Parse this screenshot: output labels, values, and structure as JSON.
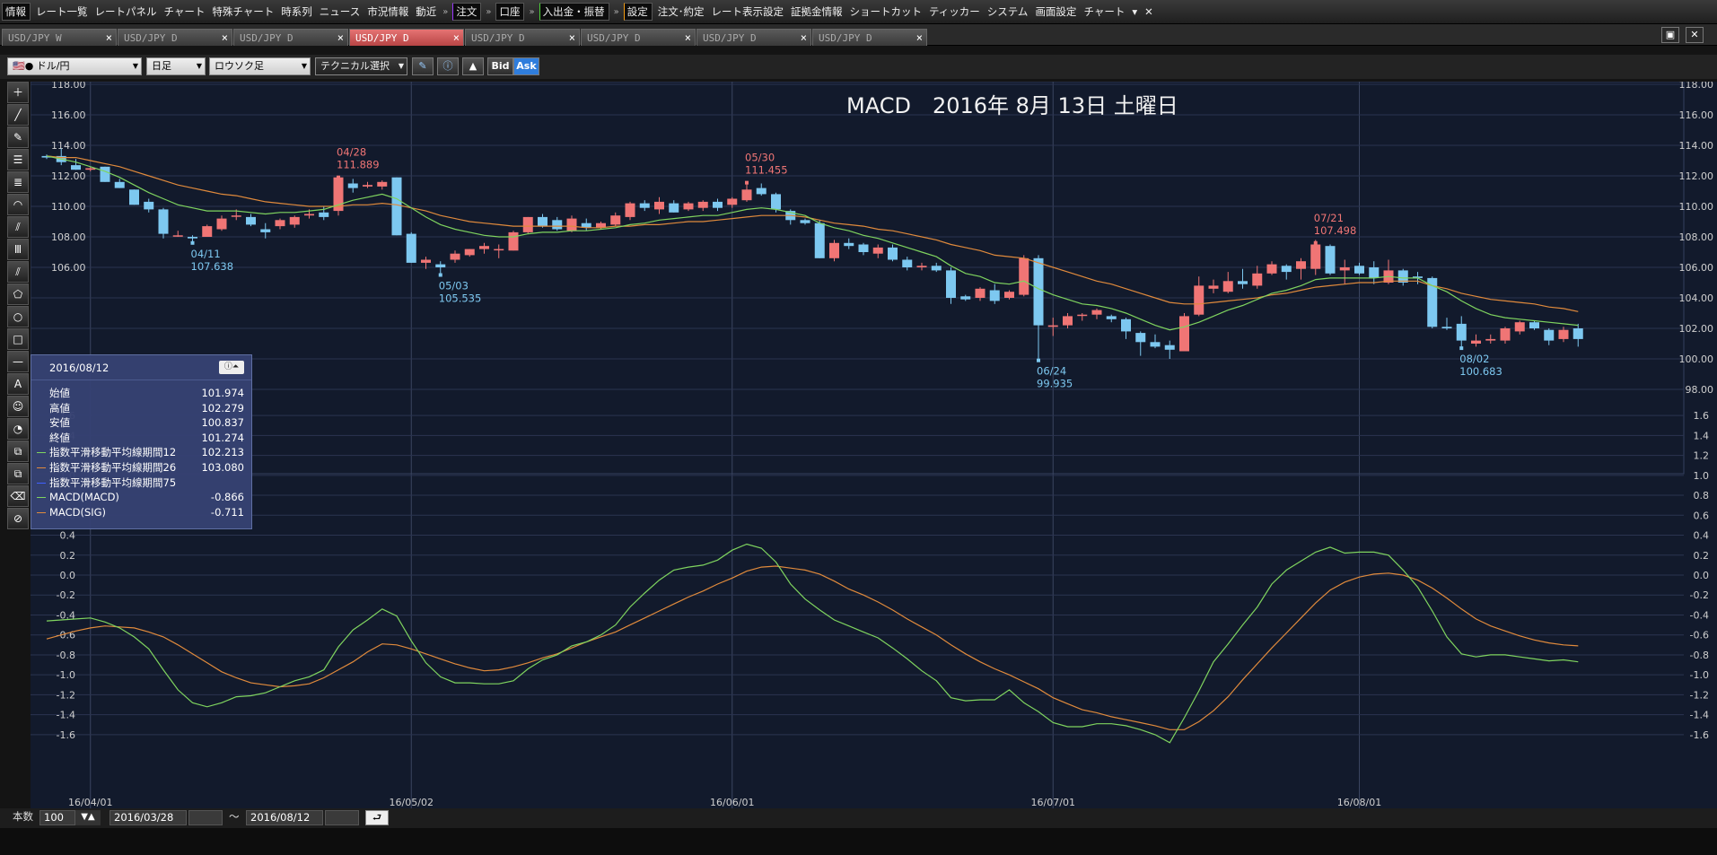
{
  "menubar": {
    "items": [
      {
        "label": "情報",
        "mark": "red",
        "boxed": true
      },
      {
        "label": "レート一覧"
      },
      {
        "label": "レートパネル"
      },
      {
        "label": "チャート"
      },
      {
        "label": "特殊チャート"
      },
      {
        "label": "時系列"
      },
      {
        "label": "ニュース"
      },
      {
        "label": "市況情報"
      },
      {
        "label": "動近"
      },
      {
        "label": "注文",
        "mark": "purple",
        "boxed": true
      },
      {
        "label": "口座",
        "mark": "red",
        "boxed": true
      },
      {
        "label": "入出金・振替",
        "mark": "green",
        "boxed": true
      },
      {
        "label": "設定",
        "mark": "orange",
        "boxed": true
      },
      {
        "label": "注文･約定"
      },
      {
        "label": "レート表示設定"
      },
      {
        "label": "証拠金情報"
      },
      {
        "label": "ショートカット"
      },
      {
        "label": "ティッカー"
      },
      {
        "label": "システム"
      },
      {
        "label": "画面設定"
      },
      {
        "label": "チャート"
      }
    ],
    "sep": "»",
    "close": "✕",
    "more": "▾"
  },
  "tabs": [
    {
      "label": "USD/JPY W",
      "active": false
    },
    {
      "label": "USD/JPY D",
      "active": false
    },
    {
      "label": "USD/JPY D",
      "active": false
    },
    {
      "label": "USD/JPY D",
      "active": true
    },
    {
      "label": "USD/JPY D",
      "active": false
    },
    {
      "label": "USD/JPY D",
      "active": false
    },
    {
      "label": "USD/JPY D",
      "active": false
    },
    {
      "label": "USD/JPY D",
      "active": false
    }
  ],
  "tab_close": "×",
  "window_controls": {
    "maximize": "▣",
    "close": "✕"
  },
  "toolbar": {
    "pair": "ドル/円",
    "period": "日足",
    "chart_type": "ロウソク足",
    "technical": "テクニカル選択",
    "bid": "Bid",
    "ask": "Ask",
    "dropdown": "▼"
  },
  "left_tools": [
    "＋",
    "╱",
    "✎",
    "☰",
    "≣",
    "◠",
    "⫽",
    "Ⅲ",
    "⫽",
    "⬠",
    "○",
    "□",
    "—",
    "A",
    "☺",
    "◔",
    "⧉",
    "⧉",
    "⌫",
    "⊘"
  ],
  "chart_data": {
    "type": "candlestick",
    "title": "MACD　2016年 8月 13日 土曜日",
    "price_axis": {
      "min": 98,
      "max": 118,
      "ticks": [
        "118.00",
        "116.00",
        "114.00",
        "112.00",
        "110.00",
        "108.00",
        "106.00",
        "104.00",
        "102.00",
        "100.00",
        "98.00"
      ],
      "left_ticks": [
        "118.00",
        "116.00",
        "114.00",
        "112.00",
        "110.00",
        "108.00",
        "106.00"
      ]
    },
    "macd_axis": {
      "min": -1.7,
      "max": 1.7,
      "ticks": [
        "1.6",
        "1.4",
        "1.2",
        "1.0",
        "0.8",
        "0.6",
        "0.4",
        "0.2",
        "0.0",
        "-0.2",
        "-0.4",
        "-0.6",
        "-0.8",
        "-1.0",
        "-1.2",
        "-1.4",
        "-1.6"
      ]
    },
    "dates": [
      "16/04/01",
      "16/05/02",
      "16/06/01",
      "16/07/01",
      "16/08/01"
    ],
    "date_index": [
      3,
      25,
      47,
      69,
      90
    ],
    "candles": [
      [
        113.3,
        113.4,
        113.1,
        113.2
      ],
      [
        113.3,
        113.8,
        112.7,
        112.9
      ],
      [
        112.7,
        113.1,
        112.4,
        112.4
      ],
      [
        112.4,
        112.6,
        112.3,
        112.5
      ],
      [
        112.6,
        112.6,
        111.6,
        111.6
      ],
      [
        111.6,
        111.8,
        111.2,
        111.2
      ],
      [
        111.1,
        111.1,
        110.1,
        110.1
      ],
      [
        110.3,
        110.5,
        109.6,
        109.8
      ],
      [
        109.8,
        109.9,
        107.9,
        108.2
      ],
      [
        108.1,
        108.4,
        108.0,
        108.1
      ],
      [
        108.0,
        108.1,
        107.6,
        107.9
      ],
      [
        108.0,
        108.8,
        108.0,
        108.7
      ],
      [
        108.5,
        109.4,
        108.4,
        109.2
      ],
      [
        109.4,
        109.8,
        109.1,
        109.4
      ],
      [
        109.3,
        109.5,
        108.7,
        108.8
      ],
      [
        108.5,
        108.9,
        107.9,
        108.3
      ],
      [
        108.7,
        109.2,
        108.5,
        109.1
      ],
      [
        108.8,
        109.4,
        108.6,
        109.3
      ],
      [
        109.4,
        109.8,
        109.2,
        109.5
      ],
      [
        109.6,
        110.0,
        109.1,
        109.3
      ],
      [
        109.7,
        112.0,
        109.4,
        111.9
      ],
      [
        111.5,
        111.8,
        110.9,
        111.2
      ],
      [
        111.3,
        111.6,
        111.2,
        111.4
      ],
      [
        111.3,
        111.7,
        111.1,
        111.6
      ],
      [
        111.9,
        111.9,
        108.1,
        108.1
      ],
      [
        108.2,
        108.3,
        106.3,
        106.3
      ],
      [
        106.3,
        106.7,
        105.9,
        106.5
      ],
      [
        106.2,
        106.4,
        105.5,
        106.0
      ],
      [
        106.5,
        107.1,
        106.3,
        106.9
      ],
      [
        106.8,
        107.2,
        106.7,
        107.2
      ],
      [
        107.2,
        107.6,
        106.9,
        107.4
      ],
      [
        107.2,
        107.5,
        106.6,
        107.2
      ],
      [
        107.1,
        108.4,
        107.1,
        108.3
      ],
      [
        108.3,
        109.3,
        108.2,
        109.3
      ],
      [
        109.3,
        109.5,
        108.6,
        108.7
      ],
      [
        109.1,
        109.3,
        108.4,
        108.5
      ],
      [
        108.4,
        109.4,
        108.3,
        109.2
      ],
      [
        108.9,
        109.2,
        108.4,
        108.6
      ],
      [
        108.6,
        109.0,
        108.5,
        108.9
      ],
      [
        108.8,
        109.6,
        108.7,
        109.4
      ],
      [
        109.3,
        110.3,
        109.1,
        110.2
      ],
      [
        110.2,
        110.4,
        109.7,
        109.9
      ],
      [
        109.8,
        110.6,
        109.5,
        110.3
      ],
      [
        110.2,
        110.4,
        109.6,
        109.6
      ],
      [
        109.8,
        110.3,
        109.7,
        110.2
      ],
      [
        109.9,
        110.4,
        109.7,
        110.3
      ],
      [
        110.3,
        110.5,
        109.7,
        109.9
      ],
      [
        110.1,
        110.6,
        109.9,
        110.5
      ],
      [
        110.4,
        111.6,
        110.3,
        111.1
      ],
      [
        111.2,
        111.5,
        110.7,
        110.8
      ],
      [
        110.8,
        110.9,
        109.6,
        109.8
      ],
      [
        109.7,
        109.8,
        108.8,
        109.1
      ],
      [
        109.1,
        109.2,
        108.8,
        108.9
      ],
      [
        108.9,
        109.1,
        106.6,
        106.6
      ],
      [
        106.6,
        107.8,
        106.4,
        107.6
      ],
      [
        107.6,
        107.9,
        107.2,
        107.4
      ],
      [
        107.5,
        107.6,
        106.8,
        107.0
      ],
      [
        106.9,
        107.5,
        106.6,
        107.3
      ],
      [
        107.3,
        107.5,
        106.4,
        106.5
      ],
      [
        106.5,
        106.7,
        105.8,
        106.0
      ],
      [
        106.0,
        106.3,
        105.8,
        106.1
      ],
      [
        106.1,
        106.3,
        105.7,
        105.8
      ],
      [
        105.8,
        106.0,
        103.6,
        104.0
      ],
      [
        104.1,
        104.2,
        103.8,
        103.9
      ],
      [
        104.0,
        104.7,
        103.8,
        104.6
      ],
      [
        104.5,
        104.9,
        103.6,
        103.8
      ],
      [
        104.0,
        104.5,
        103.9,
        104.4
      ],
      [
        104.2,
        106.8,
        104.1,
        106.6
      ],
      [
        106.6,
        106.8,
        99.9,
        102.2
      ],
      [
        102.1,
        102.7,
        101.5,
        102.2
      ],
      [
        102.2,
        103.0,
        102.0,
        102.8
      ],
      [
        102.9,
        103.0,
        102.5,
        102.9
      ],
      [
        102.9,
        103.3,
        102.6,
        103.2
      ],
      [
        102.8,
        102.9,
        102.4,
        102.6
      ],
      [
        102.6,
        102.7,
        101.3,
        101.8
      ],
      [
        101.7,
        101.8,
        100.2,
        101.1
      ],
      [
        101.1,
        101.6,
        100.7,
        100.8
      ],
      [
        100.9,
        101.2,
        100.0,
        100.6
      ],
      [
        100.5,
        103.0,
        100.5,
        102.8
      ],
      [
        102.9,
        105.4,
        102.8,
        104.8
      ],
      [
        104.6,
        105.2,
        104.3,
        104.8
      ],
      [
        104.4,
        105.7,
        104.3,
        105.1
      ],
      [
        105.1,
        105.9,
        104.6,
        104.9
      ],
      [
        104.8,
        106.1,
        104.6,
        105.6
      ],
      [
        105.6,
        106.4,
        105.5,
        106.2
      ],
      [
        106.1,
        106.2,
        105.2,
        105.7
      ],
      [
        105.9,
        106.6,
        105.2,
        106.4
      ],
      [
        105.9,
        107.8,
        105.5,
        107.5
      ],
      [
        107.4,
        107.5,
        105.5,
        105.6
      ],
      [
        105.8,
        106.5,
        104.9,
        106.0
      ],
      [
        106.1,
        106.3,
        105.5,
        105.6
      ],
      [
        106.0,
        106.4,
        104.9,
        105.3
      ],
      [
        105.0,
        106.5,
        104.9,
        105.8
      ],
      [
        105.8,
        105.9,
        104.8,
        105.0
      ],
      [
        105.4,
        105.7,
        104.9,
        105.3
      ],
      [
        105.3,
        105.4,
        102.0,
        102.1
      ],
      [
        102.1,
        102.7,
        101.9,
        102.0
      ],
      [
        102.3,
        102.8,
        100.7,
        101.2
      ],
      [
        101.0,
        101.6,
        100.8,
        101.2
      ],
      [
        101.2,
        101.6,
        101.0,
        101.3
      ],
      [
        101.2,
        102.1,
        101.0,
        102.0
      ],
      [
        101.8,
        102.5,
        101.6,
        102.4
      ],
      [
        102.4,
        102.5,
        101.9,
        102.0
      ],
      [
        101.9,
        102.0,
        100.9,
        101.2
      ],
      [
        101.3,
        102.1,
        101.1,
        101.9
      ],
      [
        102.0,
        102.3,
        100.8,
        101.3
      ]
    ],
    "ema12": [
      113.3,
      113.1,
      112.9,
      112.6,
      112.3,
      111.9,
      111.4,
      110.9,
      110.5,
      110.1,
      109.9,
      109.7,
      109.7,
      109.7,
      109.6,
      109.5,
      109.6,
      109.6,
      109.7,
      109.8,
      110.1,
      110.4,
      110.6,
      110.8,
      110.5,
      109.9,
      109.3,
      108.8,
      108.5,
      108.3,
      108.1,
      108.0,
      108.0,
      108.2,
      108.3,
      108.3,
      108.4,
      108.4,
      108.5,
      108.6,
      108.8,
      108.9,
      109.1,
      109.2,
      109.3,
      109.4,
      109.4,
      109.6,
      109.8,
      109.9,
      109.8,
      109.6,
      109.4,
      108.9,
      108.6,
      108.4,
      108.1,
      107.9,
      107.6,
      107.3,
      107.0,
      106.7,
      106.1,
      105.6,
      105.4,
      105.0,
      104.9,
      105.1,
      104.6,
      104.2,
      103.9,
      103.6,
      103.5,
      103.3,
      103.0,
      102.6,
      102.2,
      101.9,
      102.1,
      102.4,
      102.8,
      103.2,
      103.5,
      103.9,
      104.3,
      104.5,
      104.8,
      105.2,
      105.3,
      105.3,
      105.3,
      105.3,
      105.4,
      105.3,
      105.3,
      104.8,
      104.4,
      103.8,
      103.3,
      102.9,
      102.7,
      102.6,
      102.5,
      102.4,
      102.3,
      102.2
    ],
    "ema26": [
      113.3,
      113.2,
      113.2,
      113.0,
      112.8,
      112.6,
      112.3,
      112.0,
      111.7,
      111.4,
      111.2,
      111.0,
      110.8,
      110.7,
      110.5,
      110.3,
      110.2,
      110.1,
      110.0,
      110.0,
      110.0,
      110.1,
      110.1,
      110.2,
      110.1,
      109.9,
      109.7,
      109.4,
      109.2,
      109.0,
      108.9,
      108.8,
      108.7,
      108.7,
      108.7,
      108.7,
      108.7,
      108.6,
      108.6,
      108.7,
      108.7,
      108.8,
      108.8,
      108.9,
      109.0,
      109.0,
      109.1,
      109.2,
      109.3,
      109.4,
      109.4,
      109.4,
      109.3,
      109.1,
      108.9,
      108.8,
      108.7,
      108.5,
      108.4,
      108.2,
      108.0,
      107.8,
      107.5,
      107.3,
      107.1,
      106.8,
      106.7,
      106.6,
      106.3,
      106.0,
      105.7,
      105.4,
      105.1,
      104.9,
      104.6,
      104.3,
      104.0,
      103.7,
      103.6,
      103.6,
      103.7,
      103.8,
      103.9,
      104.0,
      104.2,
      104.3,
      104.5,
      104.7,
      104.8,
      104.9,
      105.0,
      105.0,
      105.1,
      105.1,
      105.1,
      104.8,
      104.6,
      104.3,
      104.1,
      103.9,
      103.8,
      103.7,
      103.6,
      103.4,
      103.3,
      103.1
    ],
    "macd": [
      -0.46,
      -0.45,
      -0.44,
      -0.43,
      -0.47,
      -0.53,
      -0.62,
      -0.74,
      -0.95,
      -1.15,
      -1.28,
      -1.32,
      -1.28,
      -1.22,
      -1.21,
      -1.18,
      -1.12,
      -1.06,
      -1.02,
      -0.95,
      -0.72,
      -0.55,
      -0.45,
      -0.34,
      -0.41,
      -0.66,
      -0.88,
      -1.02,
      -1.08,
      -1.08,
      -1.09,
      -1.09,
      -1.06,
      -0.94,
      -0.85,
      -0.8,
      -0.71,
      -0.67,
      -0.6,
      -0.5,
      -0.32,
      -0.18,
      -0.05,
      0.05,
      0.08,
      0.1,
      0.15,
      0.25,
      0.31,
      0.27,
      0.13,
      -0.09,
      -0.24,
      -0.35,
      -0.45,
      -0.51,
      -0.57,
      -0.63,
      -0.73,
      -0.84,
      -0.96,
      -1.06,
      -1.23,
      -1.26,
      -1.25,
      -1.25,
      -1.15,
      -1.28,
      -1.37,
      -1.48,
      -1.52,
      -1.52,
      -1.49,
      -1.49,
      -1.51,
      -1.55,
      -1.6,
      -1.68,
      -1.43,
      -1.16,
      -0.87,
      -0.69,
      -0.5,
      -0.32,
      -0.09,
      0.05,
      0.14,
      0.23,
      0.28,
      0.22,
      0.23,
      0.23,
      0.2,
      0.05,
      -0.12,
      -0.36,
      -0.62,
      -0.79,
      -0.82,
      -0.8,
      -0.8,
      -0.82,
      -0.84,
      -0.86,
      -0.85,
      -0.87
    ],
    "macd_sig": [
      -0.64,
      -0.6,
      -0.56,
      -0.53,
      -0.51,
      -0.52,
      -0.53,
      -0.57,
      -0.62,
      -0.7,
      -0.79,
      -0.88,
      -0.97,
      -1.03,
      -1.08,
      -1.1,
      -1.12,
      -1.11,
      -1.09,
      -1.03,
      -0.95,
      -0.87,
      -0.77,
      -0.69,
      -0.7,
      -0.74,
      -0.79,
      -0.84,
      -0.89,
      -0.93,
      -0.96,
      -0.95,
      -0.92,
      -0.88,
      -0.83,
      -0.79,
      -0.73,
      -0.67,
      -0.62,
      -0.57,
      -0.5,
      -0.43,
      -0.36,
      -0.29,
      -0.22,
      -0.16,
      -0.09,
      -0.03,
      0.04,
      0.08,
      0.09,
      0.07,
      0.05,
      0.01,
      -0.06,
      -0.14,
      -0.2,
      -0.27,
      -0.35,
      -0.44,
      -0.52,
      -0.6,
      -0.7,
      -0.79,
      -0.87,
      -0.94,
      -1.0,
      -1.07,
      -1.14,
      -1.23,
      -1.29,
      -1.35,
      -1.38,
      -1.42,
      -1.45,
      -1.48,
      -1.51,
      -1.55,
      -1.55,
      -1.47,
      -1.36,
      -1.22,
      -1.05,
      -0.89,
      -0.73,
      -0.58,
      -0.43,
      -0.28,
      -0.15,
      -0.07,
      -0.02,
      0.01,
      0.02,
      0.0,
      -0.05,
      -0.13,
      -0.23,
      -0.34,
      -0.44,
      -0.51,
      -0.56,
      -0.61,
      -0.65,
      -0.68,
      -0.7,
      -0.71
    ],
    "annotations": [
      {
        "date": "04/28",
        "value": "111.889",
        "idx": 20,
        "price": 111.9,
        "kind": "high"
      },
      {
        "date": "05/30",
        "value": "111.455",
        "idx": 48,
        "price": 111.55,
        "kind": "high"
      },
      {
        "date": "07/21",
        "value": "107.498",
        "idx": 87,
        "price": 107.6,
        "kind": "high"
      },
      {
        "date": "04/11",
        "value": "107.638",
        "idx": 10,
        "price": 107.6,
        "kind": "low"
      },
      {
        "date": "05/03",
        "value": "105.535",
        "idx": 27,
        "price": 105.5,
        "kind": "low"
      },
      {
        "date": "06/24",
        "value": "99.935",
        "idx": 68,
        "price": 99.9,
        "kind": "low"
      },
      {
        "date": "08/02",
        "value": "100.683",
        "idx": 97,
        "price": 100.7,
        "kind": "low"
      }
    ],
    "colors": {
      "up": "#f07575",
      "down": "#7dc8f0",
      "ema12": "#7fd45f",
      "ema26": "#e08a3c",
      "macd": "#7fd45f",
      "sig": "#e08a3c",
      "bg": "#121a2c",
      "grid": "#2b3450"
    }
  },
  "infobox": {
    "date": "2016/08/12",
    "btn": "ⓘ⏶",
    "rows": [
      {
        "label": "始値",
        "value": "101.974"
      },
      {
        "label": "高値",
        "value": "102.279"
      },
      {
        "label": "安値",
        "value": "100.837"
      },
      {
        "label": "終値",
        "value": "101.274"
      },
      {
        "label": "指数平滑移動平均線期間12",
        "value": "102.213",
        "color": "#7fd45f"
      },
      {
        "label": "指数平滑移動平均線期間26",
        "value": "103.080",
        "color": "#e08a3c"
      },
      {
        "label": "指数平滑移動平均線期間75",
        "value": "",
        "color": "#4060ff"
      },
      {
        "label": "MACD(MACD)",
        "value": "-0.866",
        "color": "#7fd45f"
      },
      {
        "label": "MACD(SIG)",
        "value": "-0.711",
        "color": "#e08a3c"
      }
    ]
  },
  "bottombar": {
    "count_label": "本数",
    "count": "100",
    "from": "2016/03/28",
    "tilde": "～",
    "to": "2016/08/12",
    "go": "⮐",
    "spin": "▼▲"
  }
}
